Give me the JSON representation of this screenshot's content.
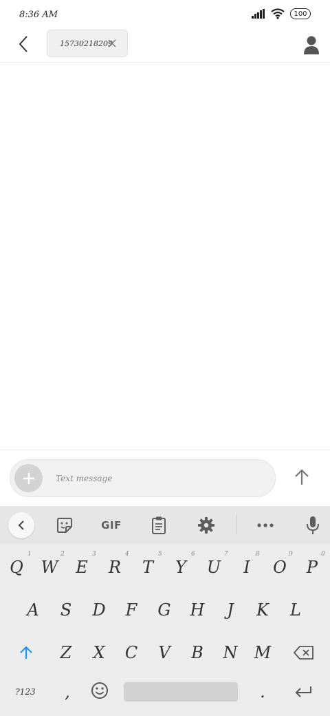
{
  "status": {
    "time": "8:36 AM",
    "battery": "100"
  },
  "header": {
    "recipient": "15730218209"
  },
  "compose": {
    "placeholder": "Text message"
  },
  "toolbar": {
    "gif_label": "GIF"
  },
  "keyboard": {
    "row1": [
      "Q",
      "W",
      "E",
      "R",
      "T",
      "Y",
      "U",
      "I",
      "O",
      "P"
    ],
    "row1_hints": [
      "1",
      "2",
      "3",
      "4",
      "5",
      "6",
      "7",
      "8",
      "9",
      "0"
    ],
    "row2": [
      "A",
      "S",
      "D",
      "F",
      "G",
      "H",
      "J",
      "K",
      "L"
    ],
    "row3": [
      "Z",
      "X",
      "C",
      "V",
      "B",
      "N",
      "M"
    ],
    "symbols_label": "?123",
    "comma": ",",
    "period": "."
  },
  "colors": {
    "accent": "#2196f3",
    "keyboard_bg": "#ececec",
    "toolbar_bg": "#e6e6e6"
  }
}
